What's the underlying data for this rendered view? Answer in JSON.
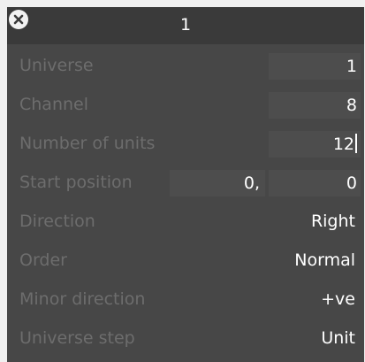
{
  "window": {
    "title": "1",
    "close_icon": "close-icon"
  },
  "fields": {
    "universe": {
      "label": "Universe",
      "value": "1"
    },
    "channel": {
      "label": "Channel",
      "value": "8"
    },
    "num_units": {
      "label": "Number of units",
      "value": "12"
    },
    "start_position": {
      "label": "Start position",
      "x": "0,",
      "y": "0"
    },
    "direction": {
      "label": "Direction",
      "value": "Right"
    },
    "order": {
      "label": "Order",
      "value": "Normal"
    },
    "minor_direction": {
      "label": "Minor direction",
      "value": "+ve"
    },
    "universe_step": {
      "label": "Universe step",
      "value": "Unit"
    }
  },
  "colors": {
    "panel_bg": "#474747",
    "title_bg": "#3a3a3a",
    "field_bg": "#4d4d4d",
    "label_text": "#6d6d6d",
    "value_text": "#ffffff"
  }
}
